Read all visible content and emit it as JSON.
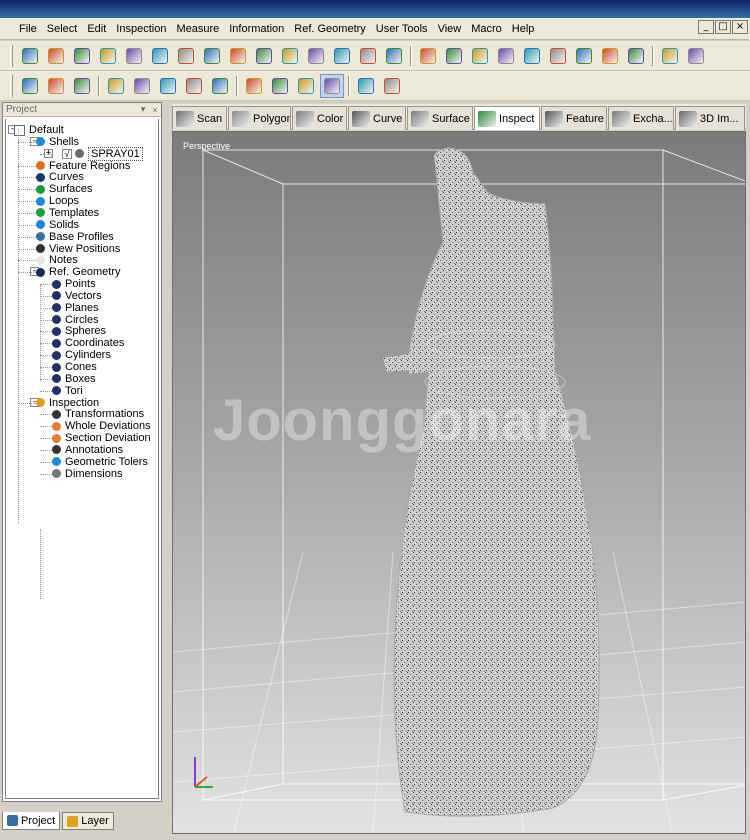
{
  "menu": [
    "File",
    "Select",
    "Edit",
    "Inspection",
    "Measure",
    "Information",
    "Ref. Geometry",
    "User Tools",
    "View",
    "Macro",
    "Help"
  ],
  "window_controls": [
    "_",
    "□",
    "×"
  ],
  "toolbar1_icons": [
    "shell-icon",
    "shell-merge-icon",
    "curve-icon",
    "tool-icon",
    "distance-icon",
    "measure-icon",
    "angle-icon",
    "circle-fit-icon",
    "vector-icon",
    "clock-icon",
    "cylinder-icon",
    "grid-icon",
    "arrow-icon",
    "branch-icon",
    "triangle-icon",
    "globe-icon",
    "dots-icon",
    "link-icon",
    "scatter-icon",
    "target-icon",
    "world-icon",
    "puzzle-icon",
    "axis-icon",
    "graph-icon",
    "bar-icon",
    "network-icon"
  ],
  "toolbar2_icons": [
    "new-icon",
    "import-icon",
    "export-icon",
    "redo-arrow-icon",
    "upload-icon",
    "document-icon",
    "transfer-icon",
    "camera-icon",
    "view-fit-icon",
    "view-box-icon",
    "undo-icon",
    "refresh-icon",
    "pointer-select-icon",
    "cursor-icon"
  ],
  "panel": {
    "title": "Project",
    "pin": "▾",
    "close": "×",
    "tree": [
      {
        "label": "Default",
        "level": 0,
        "icon": "folder-icon",
        "color": "#ffffff",
        "expander": "-"
      },
      {
        "label": "Shells",
        "level": 1,
        "icon": "shell-icon",
        "color": "#1e88d6",
        "expander": "-"
      },
      {
        "label": "SPRAY01",
        "level": 2,
        "icon": "shell-item-icon",
        "color": "#6b6b6b",
        "expander": "+",
        "selected": true,
        "check": "√"
      },
      {
        "label": "Feature Regions",
        "level": 1,
        "icon": "feature-region-icon",
        "color": "#e07020"
      },
      {
        "label": "Curves",
        "level": 1,
        "icon": "curve-icon",
        "color": "#203860"
      },
      {
        "label": "Surfaces",
        "level": 1,
        "icon": "surface-icon",
        "color": "#1a9a3a"
      },
      {
        "label": "Loops",
        "level": 1,
        "icon": "loop-icon",
        "color": "#1e88d6"
      },
      {
        "label": "Templates",
        "level": 1,
        "icon": "template-icon",
        "color": "#20a040"
      },
      {
        "label": "Solids",
        "level": 1,
        "icon": "solid-icon",
        "color": "#1e88d6"
      },
      {
        "label": "Base Profiles",
        "level": 1,
        "icon": "base-profile-icon",
        "color": "#3a6ea5"
      },
      {
        "label": "View Positions",
        "level": 1,
        "icon": "eye-icon",
        "color": "#333333"
      },
      {
        "label": "Notes",
        "level": 1,
        "icon": "note-icon",
        "color": "#e8e8e8"
      },
      {
        "label": "Ref. Geometry",
        "level": 1,
        "icon": "ref-geometry-icon",
        "color": "#1a2a5a",
        "expander": "-"
      },
      {
        "label": "Points",
        "level": 2,
        "icon": "point-icon",
        "color": "#203060"
      },
      {
        "label": "Vectors",
        "level": 2,
        "icon": "vector-icon",
        "color": "#203060"
      },
      {
        "label": "Planes",
        "level": 2,
        "icon": "plane-icon",
        "color": "#203060"
      },
      {
        "label": "Circles",
        "level": 2,
        "icon": "circle-icon",
        "color": "#203060"
      },
      {
        "label": "Spheres",
        "level": 2,
        "icon": "sphere-icon",
        "color": "#203060"
      },
      {
        "label": "Coordinates",
        "level": 2,
        "icon": "coordinate-icon",
        "color": "#203060"
      },
      {
        "label": "Cylinders",
        "level": 2,
        "icon": "cylinder-icon",
        "color": "#203060"
      },
      {
        "label": "Cones",
        "level": 2,
        "icon": "cone-icon",
        "color": "#203060"
      },
      {
        "label": "Boxes",
        "level": 2,
        "icon": "box-icon",
        "color": "#203060"
      },
      {
        "label": "Tori",
        "level": 2,
        "icon": "torus-icon",
        "color": "#203060"
      },
      {
        "label": "Inspection",
        "level": 1,
        "icon": "inspection-icon",
        "color": "#e0a020",
        "expander": "-"
      },
      {
        "label": "Transformations",
        "level": 2,
        "icon": "transformation-icon",
        "color": "#333333"
      },
      {
        "label": "Whole Deviations",
        "level": 2,
        "icon": "whole-deviation-icon",
        "color": "#e08030"
      },
      {
        "label": "Section Deviation",
        "level": 2,
        "icon": "section-deviation-icon",
        "color": "#e08030"
      },
      {
        "label": "Annotations",
        "level": 2,
        "icon": "annotation-icon",
        "color": "#333333"
      },
      {
        "label": "Geometric Tolers",
        "level": 2,
        "icon": "geometric-tolerance-icon",
        "color": "#1e88d6"
      },
      {
        "label": "Dimensions",
        "level": 2,
        "icon": "dimension-icon",
        "color": "#777777"
      }
    ]
  },
  "bottom_tabs": [
    {
      "label": "Project",
      "active": true,
      "icon": "project-tab-icon"
    },
    {
      "label": "Layer",
      "active": false,
      "icon": "layer-tab-icon"
    }
  ],
  "viewport_tabs": [
    {
      "label": "Scan",
      "icon": "scan-icon",
      "color": "#6a6a6a"
    },
    {
      "label": "Polygon",
      "icon": "polygon-icon",
      "color": "#8a8a8a"
    },
    {
      "label": "Color",
      "icon": "color-icon",
      "color": "#7a7a7a"
    },
    {
      "label": "Curve",
      "icon": "curve-icon",
      "color": "#555555"
    },
    {
      "label": "Surface",
      "icon": "surface-icon",
      "color": "#7a7a7a"
    },
    {
      "label": "Inspect",
      "icon": "inspect-icon",
      "color": "#2a8a3a",
      "active": true
    },
    {
      "label": "Feature",
      "icon": "feature-icon",
      "color": "#555555"
    },
    {
      "label": "Excha...",
      "icon": "exchange-icon",
      "color": "#777777"
    },
    {
      "label": "3D Im...",
      "icon": "3d-import-icon",
      "color": "#666666"
    }
  ],
  "viewport": {
    "label": "Perspective",
    "watermark": "Joonggonara"
  },
  "colors": {
    "title_bar": "#0a246a",
    "menu_bg": "#ece9d8",
    "viewport_top": "#7b7b7b",
    "viewport_bottom": "#e2e2e2"
  }
}
